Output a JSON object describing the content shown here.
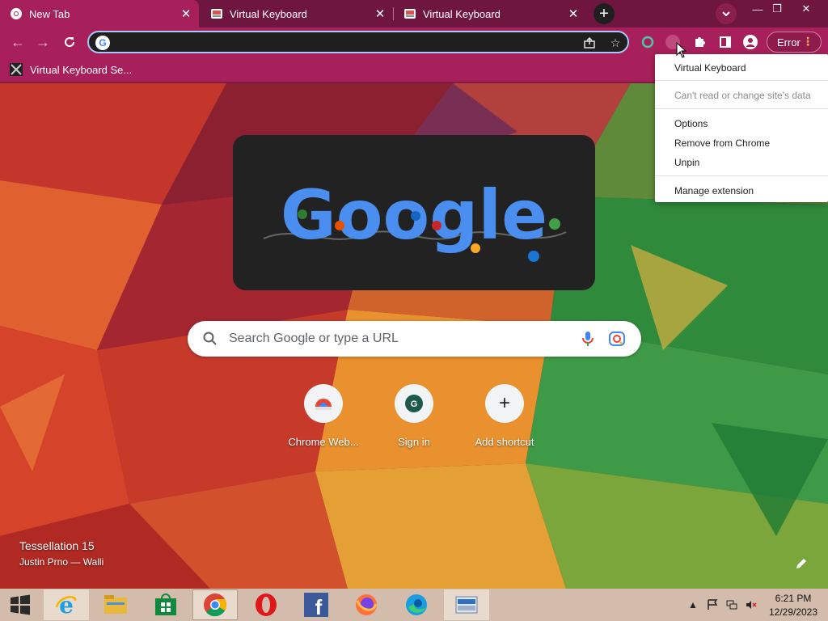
{
  "tabs": [
    {
      "title": "New Tab",
      "active": true
    },
    {
      "title": "Virtual Keyboard",
      "active": false
    },
    {
      "title": "Virtual Keyboard",
      "active": false
    }
  ],
  "omnibox": {
    "value": "",
    "placeholder": ""
  },
  "toolbar": {
    "error_label": "Error"
  },
  "bookmarks": [
    {
      "label": "Virtual Keyboard Se..."
    }
  ],
  "context_menu": {
    "extension_name": "Virtual Keyboard",
    "permission": "Can't read or change site's data",
    "options": "Options",
    "remove": "Remove from Chrome",
    "unpin": "Unpin",
    "manage": "Manage extension"
  },
  "ntp": {
    "doodle_text": "Google",
    "search_placeholder": "Search Google or type a URL",
    "shortcuts": [
      {
        "label": "Chrome Web...",
        "icon": "chrome-web-store-icon"
      },
      {
        "label": "Sign in",
        "icon": "G"
      },
      {
        "label": "Add shortcut",
        "icon": "+"
      }
    ],
    "background_title": "Tessellation 15",
    "background_author": "Justin Prno — Walli"
  },
  "taskbar": {
    "apps": [
      "start",
      "internet-explorer",
      "file-explorer",
      "store",
      "chrome",
      "opera",
      "facebook",
      "firefox",
      "edge",
      "on-screen-keyboard"
    ],
    "time": "6:21 PM",
    "date": "12/29/2023"
  },
  "colors": {
    "tab_strip": "#6e1640",
    "toolbar": "#a8205b",
    "omnibox": "#1f1f1f",
    "taskbar": "#d3bcab"
  }
}
